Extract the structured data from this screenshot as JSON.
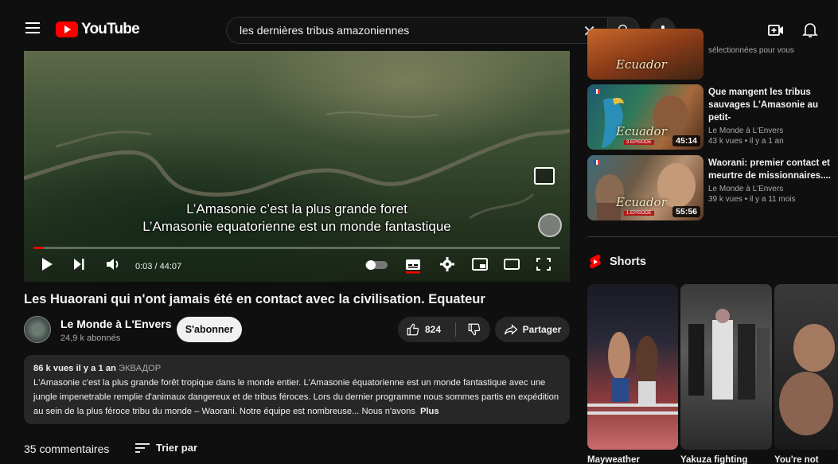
{
  "header": {
    "logo_text": "YouTube",
    "search_value": "les dernières tribus amazoniennes",
    "search_clear": "✕"
  },
  "player": {
    "caption_line1": "L’Amasonie c’est la plus grande foret",
    "caption_line2": "L’Amasonie equatorienne est un monde fantastique",
    "time": "0:03 / 44:07",
    "progress_fraction": 0.0011
  },
  "video": {
    "title": "Les Huaorani qui n'ont jamais été en contact avec la civilisation. Equateur",
    "channel_name": "Le Monde à L'Envers",
    "subscribers": "24,9 k abonnés",
    "subscribe_label": "S'abonner",
    "likes": "824",
    "share_label": "Partager"
  },
  "description": {
    "meta": "86 k vues  il y a 1 an",
    "tag": "ЭКВАДОР",
    "text": "L'Amasonie c'est la plus grande forêt tropique dans le monde entier. L'Amasonie équatorienne est un monde fantastique avec une jungle impenetrable remplie d'animaux dangereux et de tribus féroces. Lors du dernier programme nous sommes partis en expédition au sein de la plus féroce tribu du monde – Waorani. Notre équipe est nombreuse... Nous n'avons",
    "more_label": "Plus"
  },
  "comments": {
    "count_label": "35 commentaires",
    "sort_label": "Trier par"
  },
  "sidebar": {
    "top_partial_text": "sélectionnées pour vous",
    "top_partial_ecuador": "Ecuador",
    "recommendations": [
      {
        "title": "Que mangent les tribus sauvages L'Amasonie au petit-",
        "channel": "Le Monde à L'Envers",
        "meta": "43 k vues • il y a 1 an",
        "duration": "45:14",
        "thumb_text": "Ecuador",
        "thumb_episode": "3 EPISODE"
      },
      {
        "title": "Waorani: premier contact et meurtre de missionnaires....",
        "channel": "Le Monde à L'Envers",
        "meta": "39 k vues • il y a 11 mois",
        "duration": "55:56",
        "thumb_text": "Ecuador",
        "thumb_episode": "1 EPISODE"
      }
    ],
    "shorts_label": "Shorts",
    "shorts": [
      {
        "title": "Mayweather"
      },
      {
        "title": "Yakuza fighting"
      },
      {
        "title": "You're not"
      }
    ]
  },
  "colors": {
    "background": "#0f0f0f",
    "brand_red": "#ff0000",
    "pill": "#272727"
  }
}
